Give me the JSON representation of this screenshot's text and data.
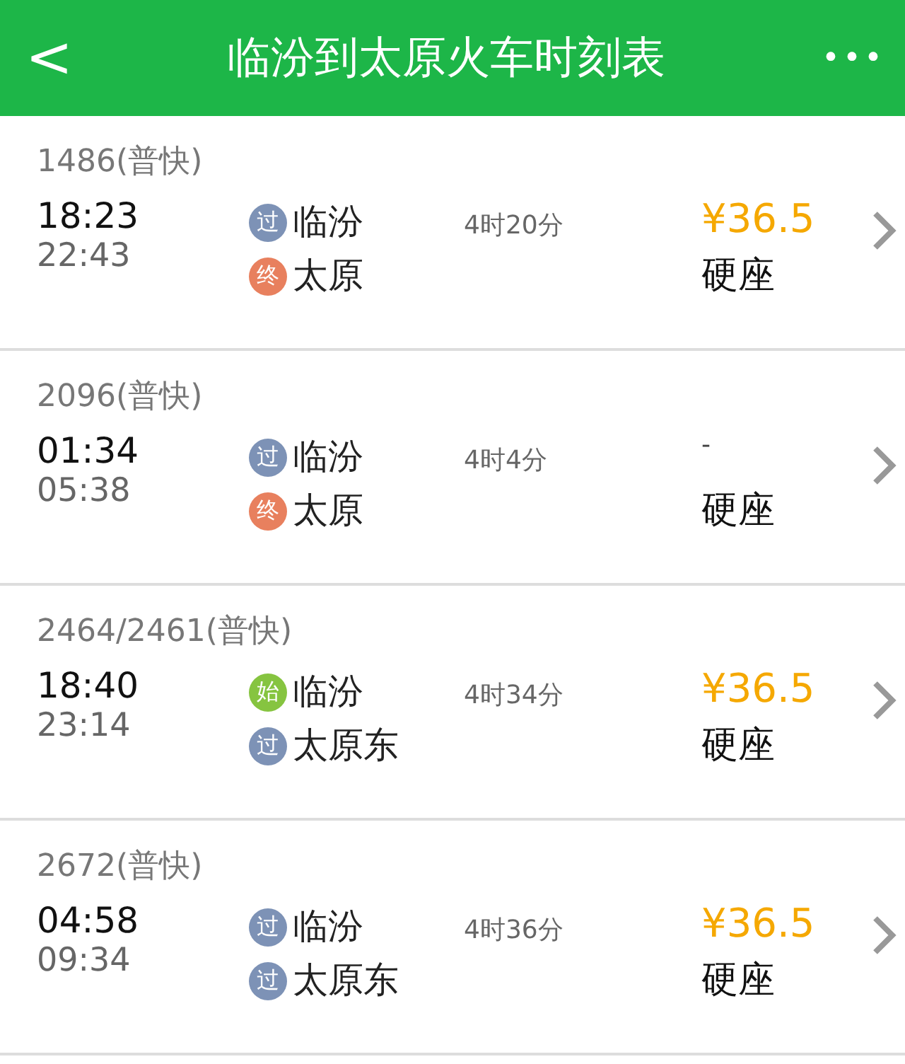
{
  "header": {
    "back": "<",
    "title": "临汾到太原火车时刻表",
    "more": "•••"
  },
  "trains": [
    {
      "number": "1486(普快)",
      "depart": "18:23",
      "arrive": "22:43",
      "from": {
        "kind": "pass",
        "tag": "过",
        "station": "临汾"
      },
      "to": {
        "kind": "end",
        "tag": "终",
        "station": "太原"
      },
      "duration": "4时20分",
      "price": "¥36.5",
      "seat": "硬座"
    },
    {
      "number": "2096(普快)",
      "depart": "01:34",
      "arrive": "05:38",
      "from": {
        "kind": "pass",
        "tag": "过",
        "station": "临汾"
      },
      "to": {
        "kind": "end",
        "tag": "终",
        "station": "太原"
      },
      "duration": "4时4分",
      "price": "-",
      "seat": "硬座"
    },
    {
      "number": "2464/2461(普快)",
      "depart": "18:40",
      "arrive": "23:14",
      "from": {
        "kind": "start",
        "tag": "始",
        "station": "临汾"
      },
      "to": {
        "kind": "pass",
        "tag": "过",
        "station": "太原东"
      },
      "duration": "4时34分",
      "price": "¥36.5",
      "seat": "硬座"
    },
    {
      "number": "2672(普快)",
      "depart": "04:58",
      "arrive": "09:34",
      "from": {
        "kind": "pass",
        "tag": "过",
        "station": "临汾"
      },
      "to": {
        "kind": "pass",
        "tag": "过",
        "station": "太原东"
      },
      "duration": "4时36分",
      "price": "¥36.5",
      "seat": "硬座"
    }
  ]
}
